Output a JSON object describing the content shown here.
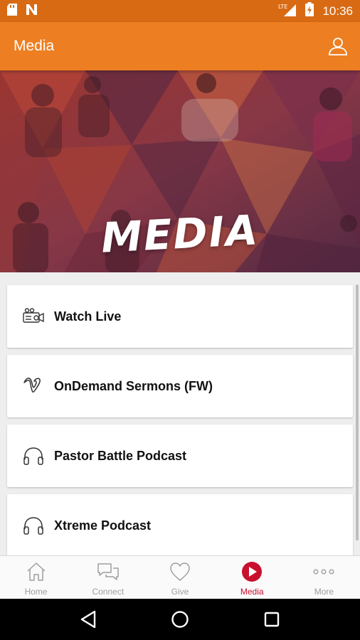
{
  "status_bar": {
    "time": "10:36",
    "network": "LTE",
    "icons": [
      "sd-card-icon",
      "notification-n-icon",
      "lte-signal-icon",
      "battery-charging-icon"
    ]
  },
  "app_bar": {
    "title": "Media",
    "profile_icon": "user-icon"
  },
  "banner": {
    "title": "MEDIA"
  },
  "media_items": [
    {
      "label": "Watch Live",
      "icon": "video-camera-icon"
    },
    {
      "label": "OnDemand Sermons (FW)",
      "icon": "vimeo-icon"
    },
    {
      "label": "Pastor Battle Podcast",
      "icon": "headphones-icon"
    },
    {
      "label": "Xtreme Podcast",
      "icon": "headphones-icon"
    }
  ],
  "tabs": [
    {
      "label": "Home",
      "icon": "home-icon",
      "active": false
    },
    {
      "label": "Connect",
      "icon": "chat-bubbles-icon",
      "active": false
    },
    {
      "label": "Give",
      "icon": "heart-icon",
      "active": false
    },
    {
      "label": "Media",
      "icon": "play-circle-icon",
      "active": true
    },
    {
      "label": "More",
      "icon": "more-dots-icon",
      "active": false
    }
  ],
  "colors": {
    "status_bar": "#d96a14",
    "app_bar": "#ed7f22",
    "active_tab": "#c8102e",
    "inactive_tab": "#9e9e9e"
  }
}
